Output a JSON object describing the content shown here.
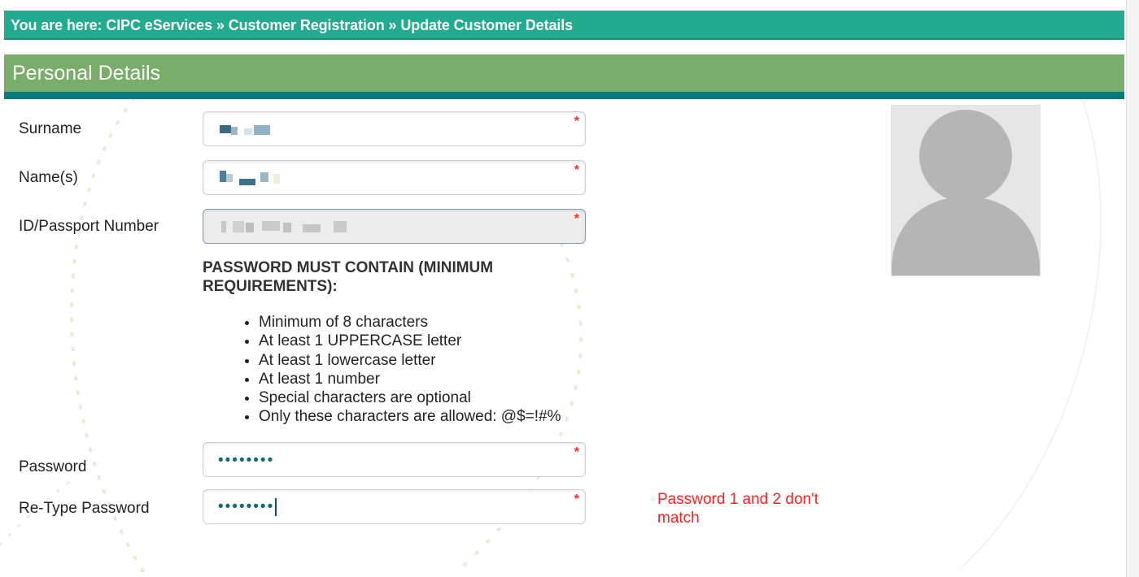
{
  "breadcrumb": {
    "text": "You are here: CIPC eServices » Customer Registration » Update Customer Details"
  },
  "section": {
    "title": "Personal Details"
  },
  "form": {
    "surname_label": "Surname",
    "names_label": "Name(s)",
    "id_label": "ID/Passport Number",
    "password_label": "Password",
    "retype_label": "Re-Type Password",
    "required_mark": "*",
    "password_value": "••••••••",
    "retype_value": "••••••••"
  },
  "requirements": {
    "title": "PASSWORD MUST CONTAIN (MINIMUM REQUIREMENTS):",
    "items": [
      "Minimum of 8 characters",
      "At least 1 UPPERCASE letter",
      "At least 1 lowercase letter",
      "At least 1 number",
      "Special characters are optional",
      "Only these characters are allowed: @$=!#%"
    ]
  },
  "validation": {
    "error": "Password 1 and 2 don't match"
  },
  "colors": {
    "breadcrumb_bg": "#22ab8e",
    "section_bg": "#78ad6a",
    "section_underline": "#0a7a7d",
    "required": "#ff2b2b",
    "error": "#ff1f1f"
  },
  "icons": {
    "avatar": "user-silhouette-icon"
  }
}
